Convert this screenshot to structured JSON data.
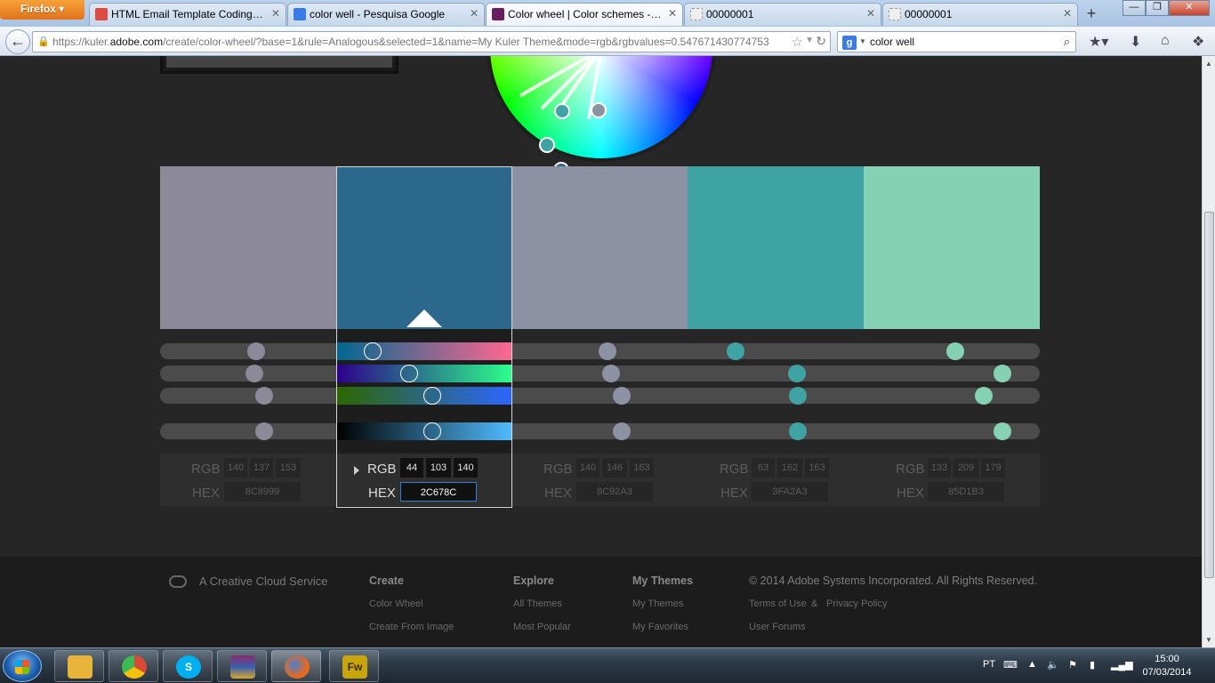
{
  "browser": {
    "menu_label": "Firefox",
    "tabs": [
      {
        "label": "HTML Email Template Coding S...",
        "fav_color": "#e04a3f",
        "active": false
      },
      {
        "label": "color well - Pesquisa Google",
        "fav_color": "#3b7be8",
        "active": false
      },
      {
        "label": "Color wheel | Color schemes - A...",
        "fav_color": "#6a1e5f",
        "active": true
      },
      {
        "label": "00000001",
        "fav_color": "#dddddd",
        "active": false
      },
      {
        "label": "00000001",
        "fav_color": "#dddddd",
        "active": false
      }
    ],
    "new_tab": "+",
    "url_prefix": "https://kuler.",
    "url_domain": "adobe.com",
    "url_rest": "/create/color-wheel/?base=1&rule=Analogous&selected=1&name=My Kuler Theme&mode=rgb&rgbvalues=0.547671430774753",
    "search_engine": "g",
    "search_query": "color well"
  },
  "palette": {
    "selected_index": 1,
    "swatches": [
      {
        "hex": "#8C8999",
        "rgb": [
          "140",
          "137",
          "153"
        ],
        "hex_label": "8C8999"
      },
      {
        "hex": "#2C678C",
        "rgb": [
          "44",
          "103",
          "140"
        ],
        "hex_label": "2C678C"
      },
      {
        "hex": "#8C92A3",
        "rgb": [
          "140",
          "146",
          "163"
        ],
        "hex_label": "8C92A3"
      },
      {
        "hex": "#3FA2A3",
        "rgb": [
          "63",
          "162",
          "163"
        ],
        "hex_label": "3FA2A3"
      },
      {
        "hex": "#85D1B3",
        "rgb": [
          "133",
          "209",
          "179"
        ],
        "hex_label": "85D1B3"
      }
    ],
    "rgb_label": "RGB",
    "hex_label": "HEX"
  },
  "footer": {
    "tagline": "A Creative Cloud Service",
    "columns": [
      {
        "heading": "Create",
        "links": [
          "Color Wheel",
          "Create From Image"
        ]
      },
      {
        "heading": "Explore",
        "links": [
          "All Themes",
          "Most Popular"
        ]
      },
      {
        "heading": "My Themes",
        "links": [
          "My Themes",
          "My Favorites"
        ]
      }
    ],
    "copyright": "© 2014 Adobe Systems Incorporated. All Rights Reserved.",
    "terms": "Terms of Use",
    "amp": "&",
    "privacy": "Privacy Policy",
    "forums": "User Forums"
  },
  "taskbar": {
    "apps": [
      {
        "name": "explorer",
        "color": "#e8b53a",
        "text": ""
      },
      {
        "name": "chrome",
        "color": "#d94a38",
        "text": ""
      },
      {
        "name": "skype",
        "color": "#00aff0",
        "text": "S"
      },
      {
        "name": "winrar",
        "color": "#8a2b6b",
        "text": ""
      },
      {
        "name": "firefox",
        "color": "#e66a1f",
        "text": ""
      },
      {
        "name": "fireworks",
        "color": "#c8a50a",
        "text": "Fw"
      }
    ],
    "lang": "PT",
    "time": "15:00",
    "date": "07/03/2014"
  }
}
